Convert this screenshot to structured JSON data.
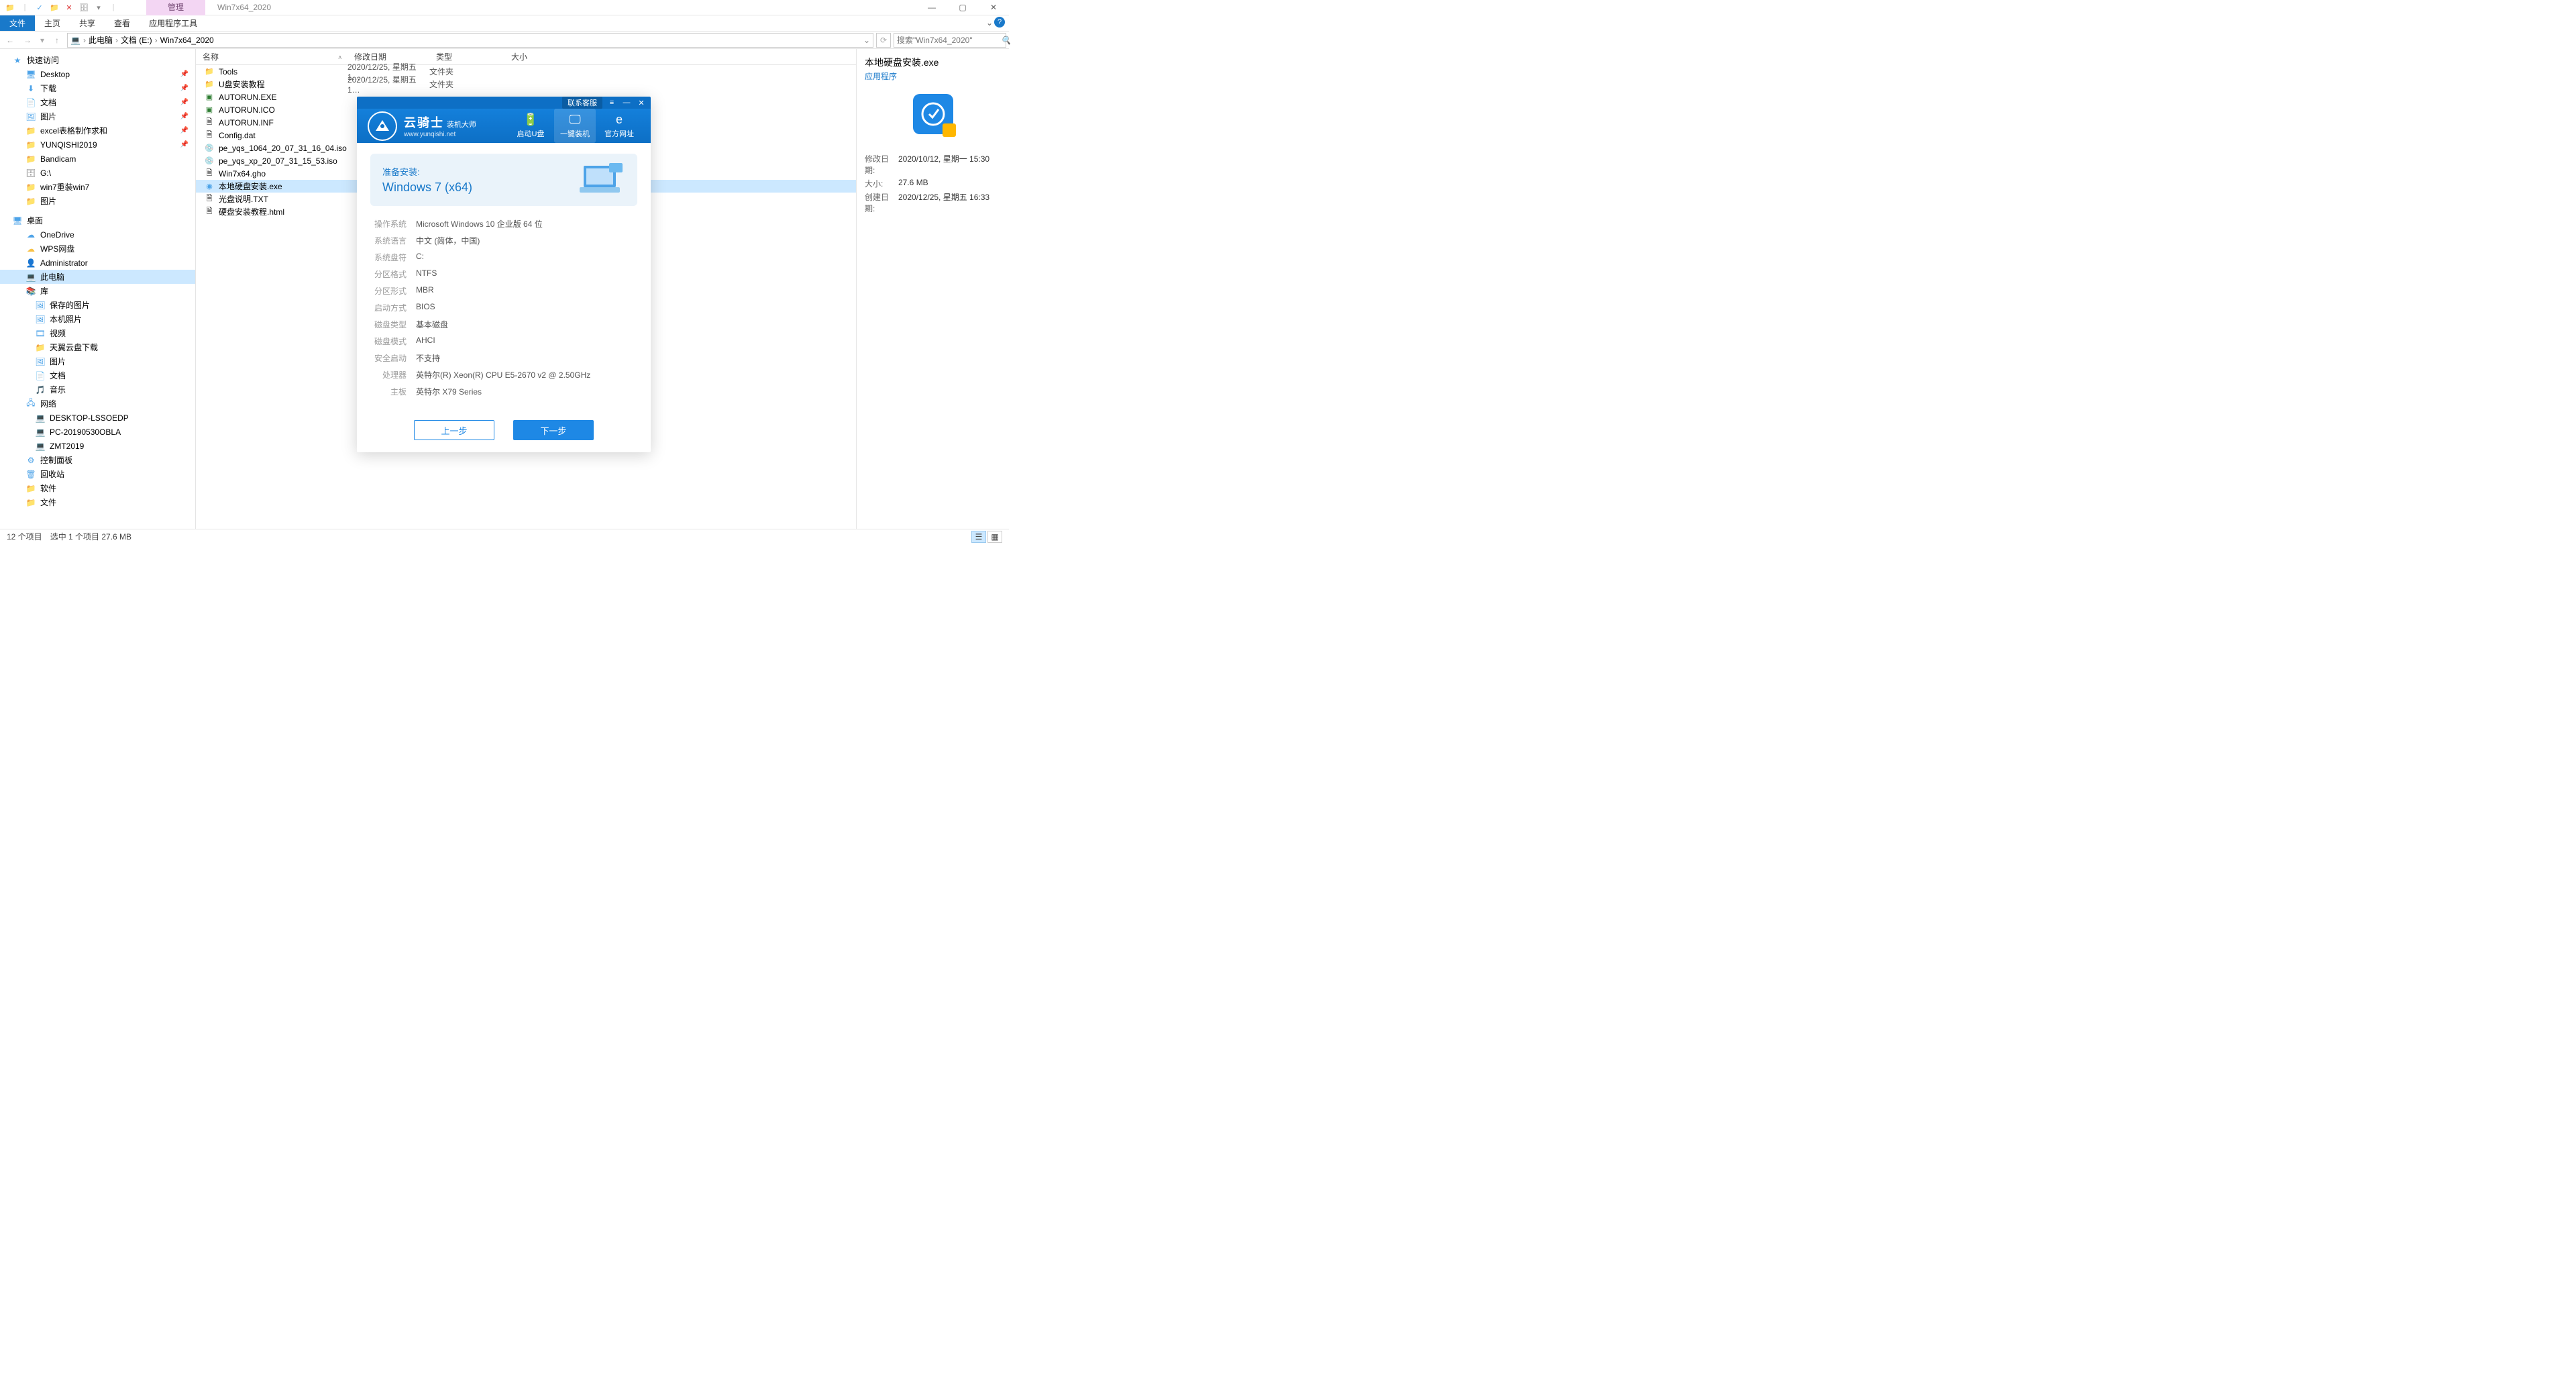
{
  "title": "Win7x64_2020",
  "ribbon_context": "管理",
  "ribbon_tabs": {
    "file": "文件",
    "home": "主页",
    "share": "共享",
    "view": "查看",
    "app": "应用程序工具"
  },
  "breadcrumb": [
    "此电脑",
    "文档 (E:)",
    "Win7x64_2020"
  ],
  "search_placeholder": "搜索\"Win7x64_2020\"",
  "columns": {
    "name": "名称",
    "date": "修改日期",
    "type": "类型",
    "size": "大小"
  },
  "nav": {
    "quick": "快速访问",
    "quick_items": [
      {
        "label": "Desktop",
        "pinned": true,
        "icon": "🖥",
        "cls": "ic-blue"
      },
      {
        "label": "下载",
        "pinned": true,
        "icon": "⬇",
        "cls": "ic-blue"
      },
      {
        "label": "文档",
        "pinned": true,
        "icon": "📄",
        "cls": "ic-blue"
      },
      {
        "label": "图片",
        "pinned": true,
        "icon": "🖼",
        "cls": "ic-blue"
      },
      {
        "label": "excel表格制作求和",
        "pinned": true,
        "icon": "📁",
        "cls": "ic-folder"
      },
      {
        "label": "YUNQISHI2019",
        "pinned": true,
        "icon": "📁",
        "cls": "ic-folder"
      },
      {
        "label": "Bandicam",
        "pinned": false,
        "icon": "📁",
        "cls": "ic-folder"
      },
      {
        "label": "G:\\",
        "pinned": false,
        "icon": "🗄",
        "cls": "ic-disk"
      },
      {
        "label": "win7重装win7",
        "pinned": false,
        "icon": "📁",
        "cls": "ic-folder"
      },
      {
        "label": "图片",
        "pinned": false,
        "icon": "📁",
        "cls": "ic-folder"
      }
    ],
    "desktop": "桌面",
    "desktop_items": [
      {
        "label": "OneDrive",
        "icon": "☁",
        "cls": "ic-blue"
      },
      {
        "label": "WPS网盘",
        "icon": "☁",
        "cls": "ic-folder"
      },
      {
        "label": "Administrator",
        "icon": "👤",
        "cls": "ic-folder"
      },
      {
        "label": "此电脑",
        "icon": "💻",
        "cls": "ic-blue",
        "selected": true
      },
      {
        "label": "库",
        "icon": "📚",
        "cls": "ic-folder"
      }
    ],
    "lib_items": [
      {
        "label": "保存的图片",
        "icon": "🖼",
        "cls": "ic-blue"
      },
      {
        "label": "本机照片",
        "icon": "🖼",
        "cls": "ic-blue"
      },
      {
        "label": "视频",
        "icon": "🎞",
        "cls": "ic-blue"
      },
      {
        "label": "天翼云盘下载",
        "icon": "📁",
        "cls": "ic-blue"
      },
      {
        "label": "图片",
        "icon": "🖼",
        "cls": "ic-blue"
      },
      {
        "label": "文档",
        "icon": "📄",
        "cls": "ic-blue"
      },
      {
        "label": "音乐",
        "icon": "🎵",
        "cls": "ic-blue"
      }
    ],
    "network": "网络",
    "net_items": [
      {
        "label": "DESKTOP-LSSOEDP",
        "icon": "💻",
        "cls": "ic-blue"
      },
      {
        "label": "PC-20190530OBLA",
        "icon": "💻",
        "cls": "ic-blue"
      },
      {
        "label": "ZMT2019",
        "icon": "💻",
        "cls": "ic-blue"
      }
    ],
    "extras": [
      {
        "label": "控制面板",
        "icon": "⚙",
        "cls": "ic-blue"
      },
      {
        "label": "回收站",
        "icon": "🗑",
        "cls": "ic-blue"
      },
      {
        "label": "软件",
        "icon": "📁",
        "cls": "ic-folder"
      },
      {
        "label": "文件",
        "icon": "📁",
        "cls": "ic-folder"
      }
    ]
  },
  "files": [
    {
      "name": "Tools",
      "date": "2020/12/25, 星期五 1…",
      "type": "文件夹",
      "icon": "📁",
      "cls": "ic-folder"
    },
    {
      "name": "U盘安装教程",
      "date": "2020/12/25, 星期五 1…",
      "type": "文件夹",
      "icon": "📁",
      "cls": "ic-folder"
    },
    {
      "name": "AUTORUN.EXE",
      "date": "",
      "type": "",
      "icon": "▣",
      "cls": "ic-green"
    },
    {
      "name": "AUTORUN.ICO",
      "date": "",
      "type": "",
      "icon": "▣",
      "cls": "ic-green"
    },
    {
      "name": "AUTORUN.INF",
      "date": "",
      "type": "",
      "icon": "🗎",
      "cls": ""
    },
    {
      "name": "Config.dat",
      "date": "",
      "type": "",
      "icon": "🗎",
      "cls": ""
    },
    {
      "name": "pe_yqs_1064_20_07_31_16_04.iso",
      "date": "",
      "type": "",
      "icon": "💿",
      "cls": "ic-disc"
    },
    {
      "name": "pe_yqs_xp_20_07_31_15_53.iso",
      "date": "",
      "type": "",
      "icon": "💿",
      "cls": "ic-disc"
    },
    {
      "name": "Win7x64.gho",
      "date": "",
      "type": "",
      "icon": "🗎",
      "cls": ""
    },
    {
      "name": "本地硬盘安装.exe",
      "date": "",
      "type": "",
      "icon": "◉",
      "cls": "ic-blue",
      "selected": true
    },
    {
      "name": "光盘说明.TXT",
      "date": "",
      "type": "",
      "icon": "🗎",
      "cls": ""
    },
    {
      "name": "硬盘安装教程.html",
      "date": "",
      "type": "",
      "icon": "🗎",
      "cls": ""
    }
  ],
  "details": {
    "title": "本地硬盘安装.exe",
    "subtype": "应用程序",
    "rows": [
      {
        "k": "修改日期:",
        "v": "2020/10/12, 星期一 15:30"
      },
      {
        "k": "大小:",
        "v": "27.6 MB"
      },
      {
        "k": "创建日期:",
        "v": "2020/12/25, 星期五 16:33"
      }
    ]
  },
  "status": {
    "count": "12 个项目",
    "selected": "选中 1 个项目  27.6 MB"
  },
  "dialog": {
    "support": "联系客服",
    "brand": "云骑士",
    "brand_sub": "装机大师",
    "url": "www.yunqishi.net",
    "tabs": [
      {
        "label": "启动U盘",
        "icon": "🔋"
      },
      {
        "label": "一键装机",
        "icon": "🖵",
        "active": true
      },
      {
        "label": "官方网址",
        "icon": "e"
      }
    ],
    "prep_title": "准备安装:",
    "prep_target": "Windows 7 (x64)",
    "info": [
      {
        "k": "操作系统",
        "v": "Microsoft Windows 10 企业版 64 位"
      },
      {
        "k": "系统语言",
        "v": "中文 (简体，中国)"
      },
      {
        "k": "系统盘符",
        "v": "C:"
      },
      {
        "k": "分区格式",
        "v": "NTFS"
      },
      {
        "k": "分区形式",
        "v": "MBR"
      },
      {
        "k": "启动方式",
        "v": "BIOS"
      },
      {
        "k": "磁盘类型",
        "v": "基本磁盘"
      },
      {
        "k": "磁盘模式",
        "v": "AHCI"
      },
      {
        "k": "安全启动",
        "v": "不支持"
      },
      {
        "k": "处理器",
        "v": "英特尔(R) Xeon(R) CPU E5-2670 v2 @ 2.50GHz"
      },
      {
        "k": "主板",
        "v": "英特尔 X79 Series"
      }
    ],
    "btn_prev": "上一步",
    "btn_next": "下一步"
  }
}
